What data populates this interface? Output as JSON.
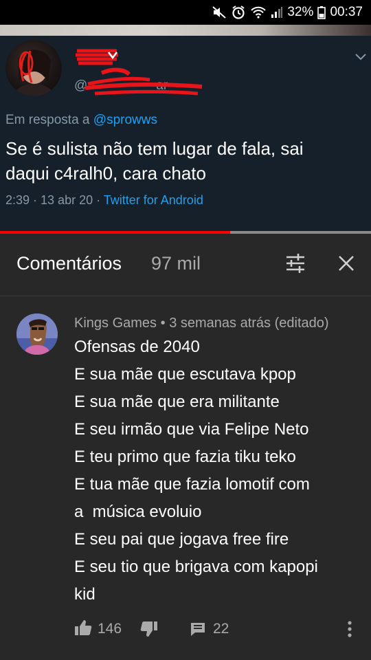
{
  "status_bar": {
    "battery_percent": "32%",
    "time": "00:37",
    "icons": [
      "mute-icon",
      "alarm-icon",
      "wifi-icon",
      "signal-icon",
      "battery-icon"
    ]
  },
  "tweet": {
    "handle_fragment": "ar",
    "reply_prefix": "Em resposta a",
    "reply_mention": "@sprowws",
    "text_line1": "Se é sulista não tem lugar de fala, sai",
    "text_line2": "daqui c4ralh0, cara chato",
    "date": "2:39 · 13 abr 20 · ",
    "client": "Twitter for Android",
    "colors": {
      "background": "#15202b",
      "link": "#1da1f2",
      "muted": "#8899a6"
    }
  },
  "player": {
    "progress": 0.62,
    "colors": {
      "played": "#ff0000",
      "track": "#8a8a8a"
    }
  },
  "comments_header": {
    "title": "Comentários",
    "count": "97 mil"
  },
  "comment": {
    "author": "Kings Games",
    "separator": " • ",
    "time": "3 semanas atrás (editado)",
    "lines": [
      "Ofensas de 2040",
      "E sua mãe que escutava kpop",
      "E sua mãe que era militante",
      "E seu irmão que via Felipe Neto",
      "E teu primo que fazia tiku teko",
      "E tua mãe que fazia lomotif com",
      "a  música evoluio",
      "E seu pai que jogava free fire",
      "E seu tio que brigava com kapopi",
      "kid"
    ],
    "likes": "146",
    "replies": "22"
  }
}
